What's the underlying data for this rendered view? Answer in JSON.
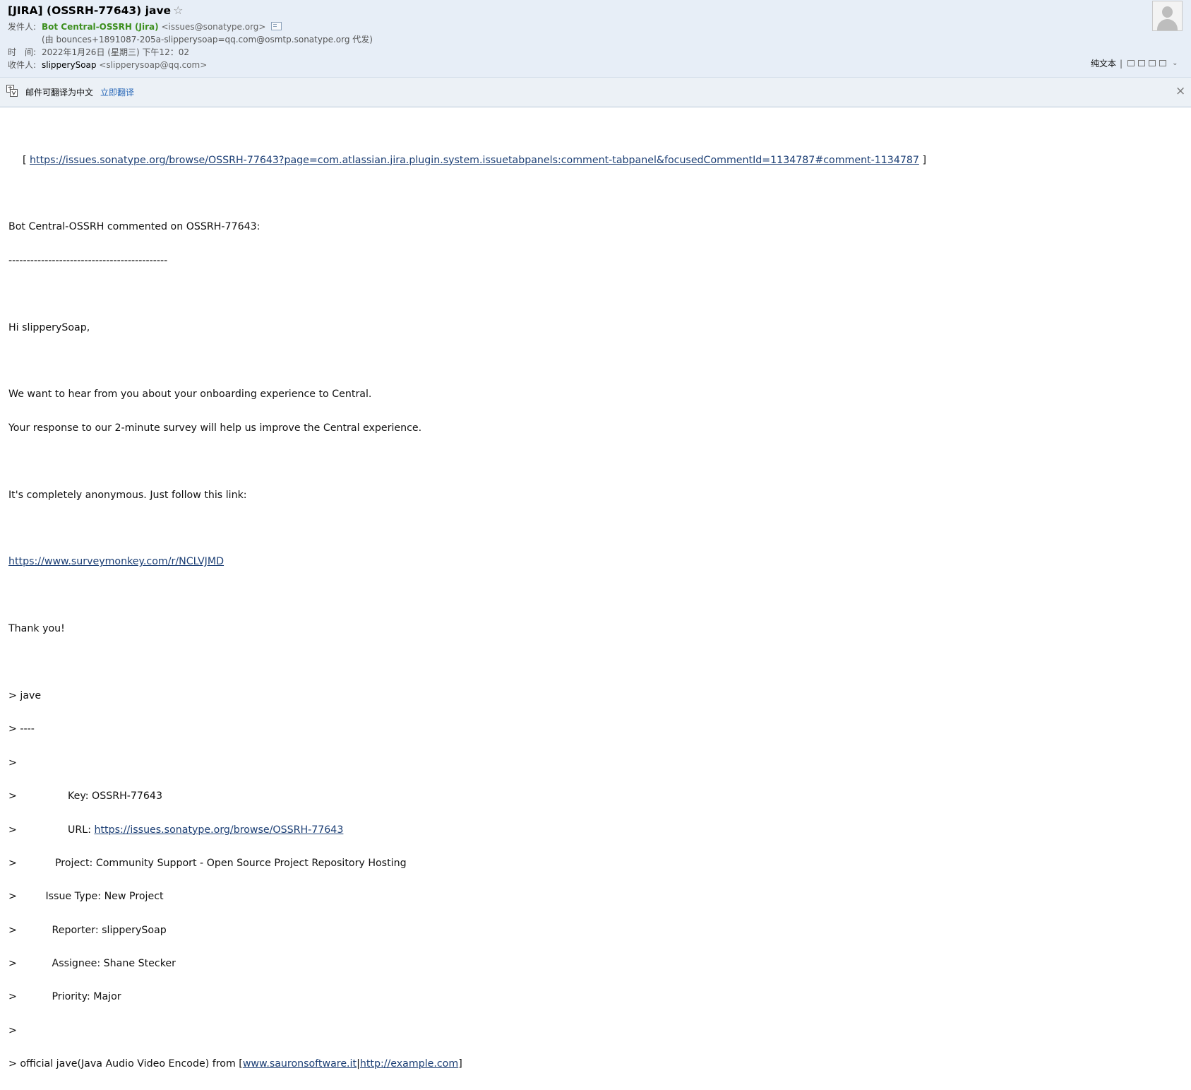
{
  "header": {
    "subject": "[JIRA] (OSSRH-77643) jave",
    "star_icon": "star-outline-icon",
    "from_label": "发件人:",
    "sender_name": "Bot Central-OSSRH (Jira)",
    "sender_email": "<issues@sonatype.org>",
    "proxy_line": "(由 bounces+1891087-205a-slipperysoap=qq.com@osmtp.sonatype.org 代发)",
    "time_label": "时　间:",
    "time_value": "2022年1月26日 (星期三) 下午12：02",
    "to_label": "收件人:",
    "recipient_name": "slipperySoap",
    "recipient_email": "<slipperysoap@qq.com>",
    "plain_text": "纯文本",
    "separator": "|"
  },
  "translate_bar": {
    "message": "邮件可翻译为中文",
    "action": "立即翻译",
    "close": "×"
  },
  "body": {
    "top_link_open": "[ ",
    "top_link": "https://issues.sonatype.org/browse/OSSRH-77643?page=com.atlassian.jira.plugin.system.issuetabpanels:comment-tabpanel&focusedCommentId=1134787#comment-1134787",
    "top_link_close": " ]",
    "commented": "Bot Central-OSSRH commented on OSSRH-77643:",
    "divider": "--------------------------------------------",
    "greeting": "Hi slipperySoap,",
    "para1_line1": "We want to hear from you about your onboarding experience to Central.",
    "para1_line2": "Your response to our 2-minute survey will help us improve the Central experience.",
    "para2": "It's completely anonymous. Just follow this link:",
    "survey_link": "https://www.surveymonkey.com/r/NCLVJMD",
    "thanks": "Thank you!",
    "quote_title": "> jave",
    "quote_rule": "> ----",
    "quote_blank": ">",
    "key_prefix": ">                Key: ",
    "key_value": "OSSRH-77643",
    "url_prefix": ">                URL: ",
    "url_value": "https://issues.sonatype.org/browse/OSSRH-77643",
    "project_prefix": ">            Project: ",
    "project_value": "Community Support - Open Source Project Repository Hosting",
    "issue_type_prefix": ">         Issue Type: ",
    "issue_type_value": "New Project",
    "reporter_prefix": ">           Reporter: ",
    "reporter_value": "slipperySoap",
    "assignee_prefix": ">           Assignee: ",
    "assignee_value": "Shane Stecker",
    "priority_prefix": ">           Priority: ",
    "priority_value": "Major",
    "desc_prefix": "> official jave(Java Audio Video Encode) from [",
    "desc_link1": "www.sauronsoftware.it",
    "desc_sep": "|",
    "desc_link2": "http://example.com",
    "desc_suffix": "]"
  }
}
